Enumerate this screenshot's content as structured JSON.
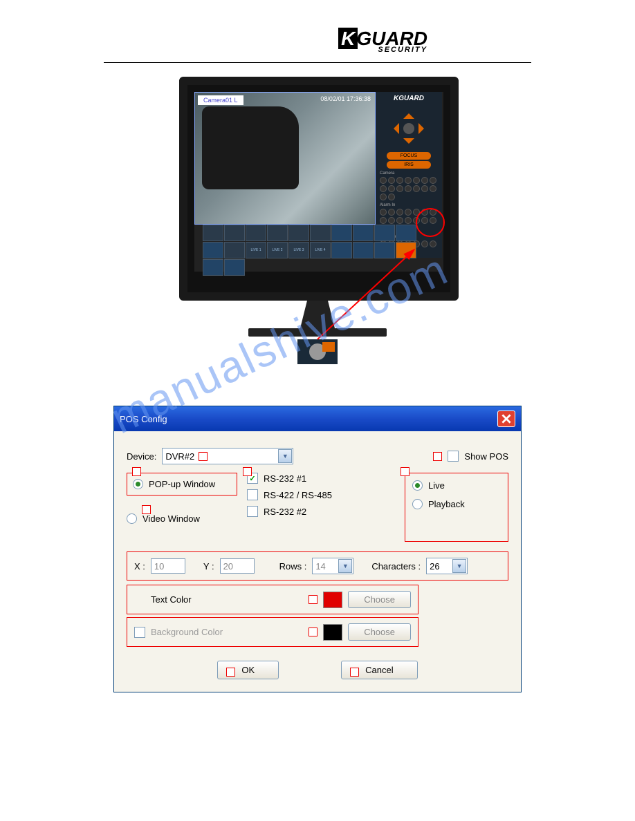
{
  "brand": {
    "name": "GUARD",
    "sub": "SECURITY",
    "k": "K"
  },
  "monitor": {
    "camera_label": "Camera01 L",
    "timestamp": "08/02/01  17:36:38",
    "side_logo": "KGUARD",
    "focus": "FOCUS",
    "iris": "IRIS",
    "camera_sec": "Camera",
    "alarmin_sec": "Alarm In",
    "alarmout_sec": "Alarm Out",
    "live_btns": [
      "LIVE 1",
      "LIVE 2",
      "LIVE 3",
      "LIVE 4"
    ]
  },
  "watermark": "manualshive.com",
  "dialog": {
    "title": "POS Config",
    "device_label": "Device:",
    "device_value": "DVR#2",
    "show_pos": "Show POS",
    "popup_window": "POP-up Window",
    "video_window": "Video Window",
    "rs232_1": "RS-232 #1",
    "rs422": "RS-422 / RS-485",
    "rs232_2": "RS-232 #2",
    "live": "Live",
    "playback": "Playback",
    "x_label": "X :",
    "x_value": "10",
    "y_label": "Y :",
    "y_value": "20",
    "rows_label": "Rows :",
    "rows_value": "14",
    "chars_label": "Characters :",
    "chars_value": "26",
    "text_color": "Text Color",
    "bg_color": "Background Color",
    "choose": "Choose",
    "ok": "OK",
    "cancel": "Cancel",
    "text_swatch": "#e00000",
    "bg_swatch": "#000000"
  }
}
